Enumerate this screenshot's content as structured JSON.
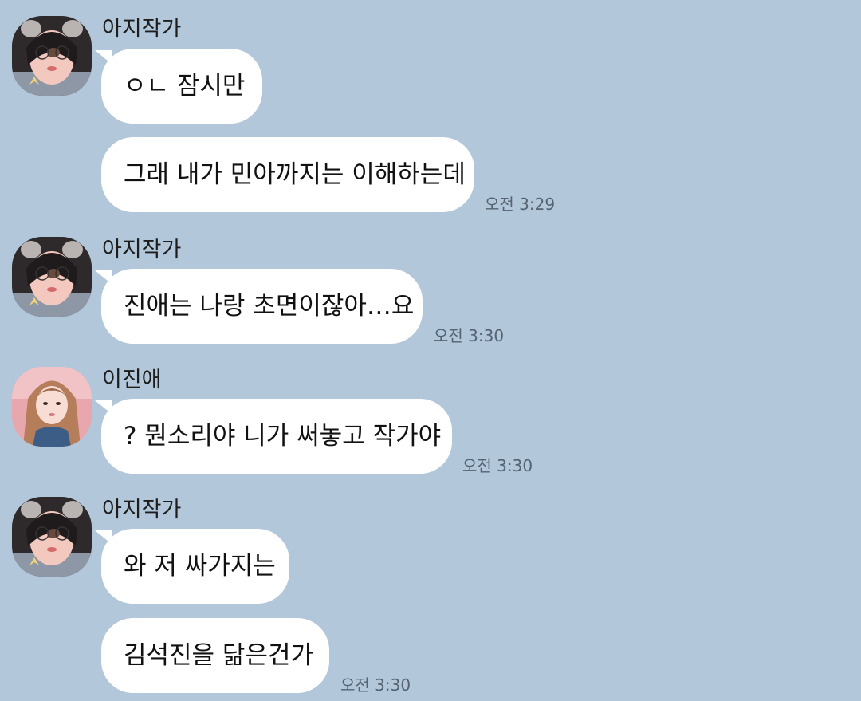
{
  "chat": {
    "messages": [
      {
        "sender": "아지작가",
        "avatar": "avatar-ajijakga",
        "lines": [
          "ㅇㄴ 잠시만",
          "그래 내가 민아까지는 이해하는데"
        ],
        "time": "오전 3:29"
      },
      {
        "sender": "아지작가",
        "avatar": "avatar-ajijakga",
        "lines": [
          "진애는 나랑 초면이잖아…요"
        ],
        "time": "오전 3:30"
      },
      {
        "sender": "이진애",
        "avatar": "avatar-ijinae",
        "lines": [
          "?  뭔소리야 니가 써놓고 작가야"
        ],
        "time": "오전 3:30"
      },
      {
        "sender": "아지작가",
        "avatar": "avatar-ajijakga",
        "lines": [
          "와 저 싸가지는",
          "김석진을 닮은건가"
        ],
        "time": "오전 3:30"
      }
    ]
  },
  "colors": {
    "background": "#b2c7da",
    "bubble": "#ffffff",
    "text": "#111111",
    "time": "#556270"
  }
}
